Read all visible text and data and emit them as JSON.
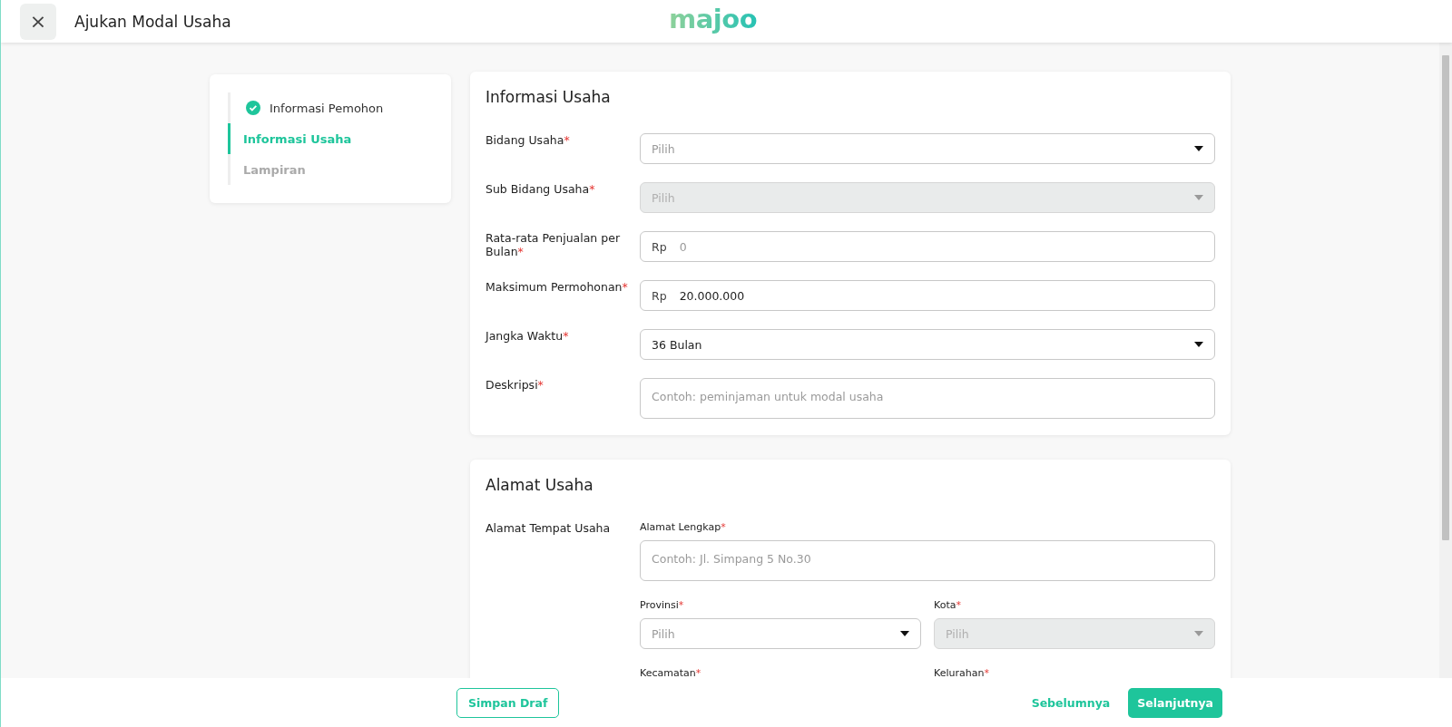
{
  "header": {
    "close_icon": "×",
    "title": "Ajukan Modal Usaha",
    "logo": "majoo"
  },
  "steps": [
    {
      "label": "Informasi Pemohon",
      "completed": true,
      "selected": false
    },
    {
      "label": "Informasi Usaha",
      "completed": false,
      "selected": true
    },
    {
      "label": "Lampiran",
      "completed": false,
      "selected": false
    }
  ],
  "business_info": {
    "title": "Informasi Usaha",
    "fields": [
      {
        "label": "Bidang Usaha",
        "mark": "*",
        "kind": "select",
        "placeholder": "Pilih",
        "disabled": false
      },
      {
        "label": "Sub Bidang Usaha",
        "mark": "*",
        "kind": "select",
        "placeholder": "Pilih",
        "disabled": true
      },
      {
        "label": "Rata-rata Penjualan per Bulan",
        "mark": "*",
        "kind": "currency",
        "prefix": "Rp",
        "placeholder": "0",
        "disabled": false
      },
      {
        "label": "Maksimum Permohonan",
        "mark": "*",
        "kind": "currency",
        "prefix": "Rp",
        "value": "20.000.000",
        "disabled": false
      },
      {
        "label": "Jangka Waktu",
        "mark": "*",
        "kind": "select",
        "value": "36 Bulan",
        "disabled": false
      },
      {
        "label": "Deskripsi",
        "mark": "*",
        "kind": "textarea",
        "placeholder": "Contoh: peminjaman untuk modal usaha",
        "disabled": false
      }
    ]
  },
  "business_address": {
    "title": "Alamat Usaha",
    "group_label": "Alamat Tempat Usaha",
    "full_address": {
      "label": "Alamat Lengkap",
      "mark": "*",
      "placeholder": "Contoh: Jl. Simpang 5 No.30"
    },
    "fields": [
      {
        "label": "Provinsi",
        "mark": "*",
        "kind": "select",
        "placeholder": "Pilih",
        "disabled": false
      },
      {
        "label": "Kota",
        "mark": "*",
        "kind": "select",
        "placeholder": "Pilih",
        "disabled": true
      },
      {
        "label": "Kecamatan",
        "mark": "*",
        "kind": "label_only"
      },
      {
        "label": "Kelurahan",
        "mark": "*",
        "kind": "label_only"
      }
    ]
  },
  "footer": {
    "draft_button": "Simpan Draf",
    "back_link": "Sebelumnya",
    "next_button": "Selanjutnya"
  }
}
